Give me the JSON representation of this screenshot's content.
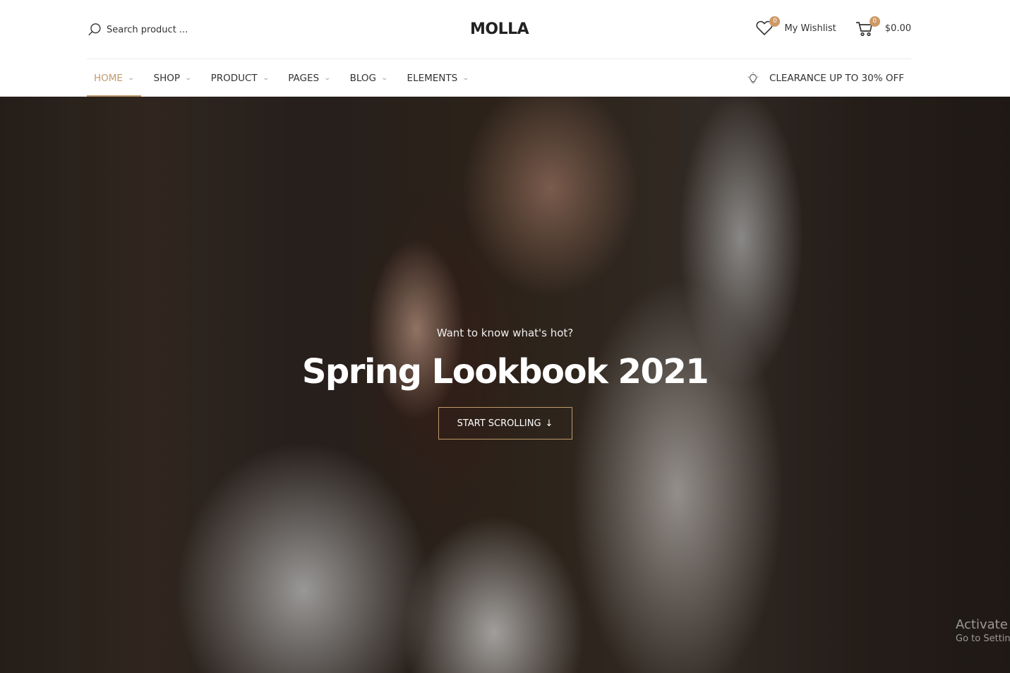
{
  "header": {
    "search": {
      "placeholder": "Search product ...",
      "value": "",
      "icon": "search-icon"
    },
    "logo": "MOLLA",
    "wishlist": {
      "label": "My Wishlist",
      "count": "0",
      "icon": "heart-icon"
    },
    "cart": {
      "total": "$0.00",
      "count": "0",
      "icon": "cart-icon"
    }
  },
  "nav": {
    "items": [
      {
        "label": "Home",
        "active": true
      },
      {
        "label": "Shop"
      },
      {
        "label": "Product"
      },
      {
        "label": "Pages"
      },
      {
        "label": "Blog"
      },
      {
        "label": "Elements"
      }
    ],
    "promo": {
      "label": "Clearance Up to 30% Off",
      "icon": "lightbulb-icon"
    }
  },
  "hero": {
    "subtitle": "Want to know what's hot?",
    "title": "Spring Lookbook 2021",
    "button_label": "START SCROLLING",
    "button_icon": "↓"
  },
  "os_watermark": {
    "line1": "Activate",
    "line2": "Go to Settin"
  },
  "colors": {
    "accent": "#c09a6b",
    "badge": "#cc9966",
    "text": "#333333"
  }
}
